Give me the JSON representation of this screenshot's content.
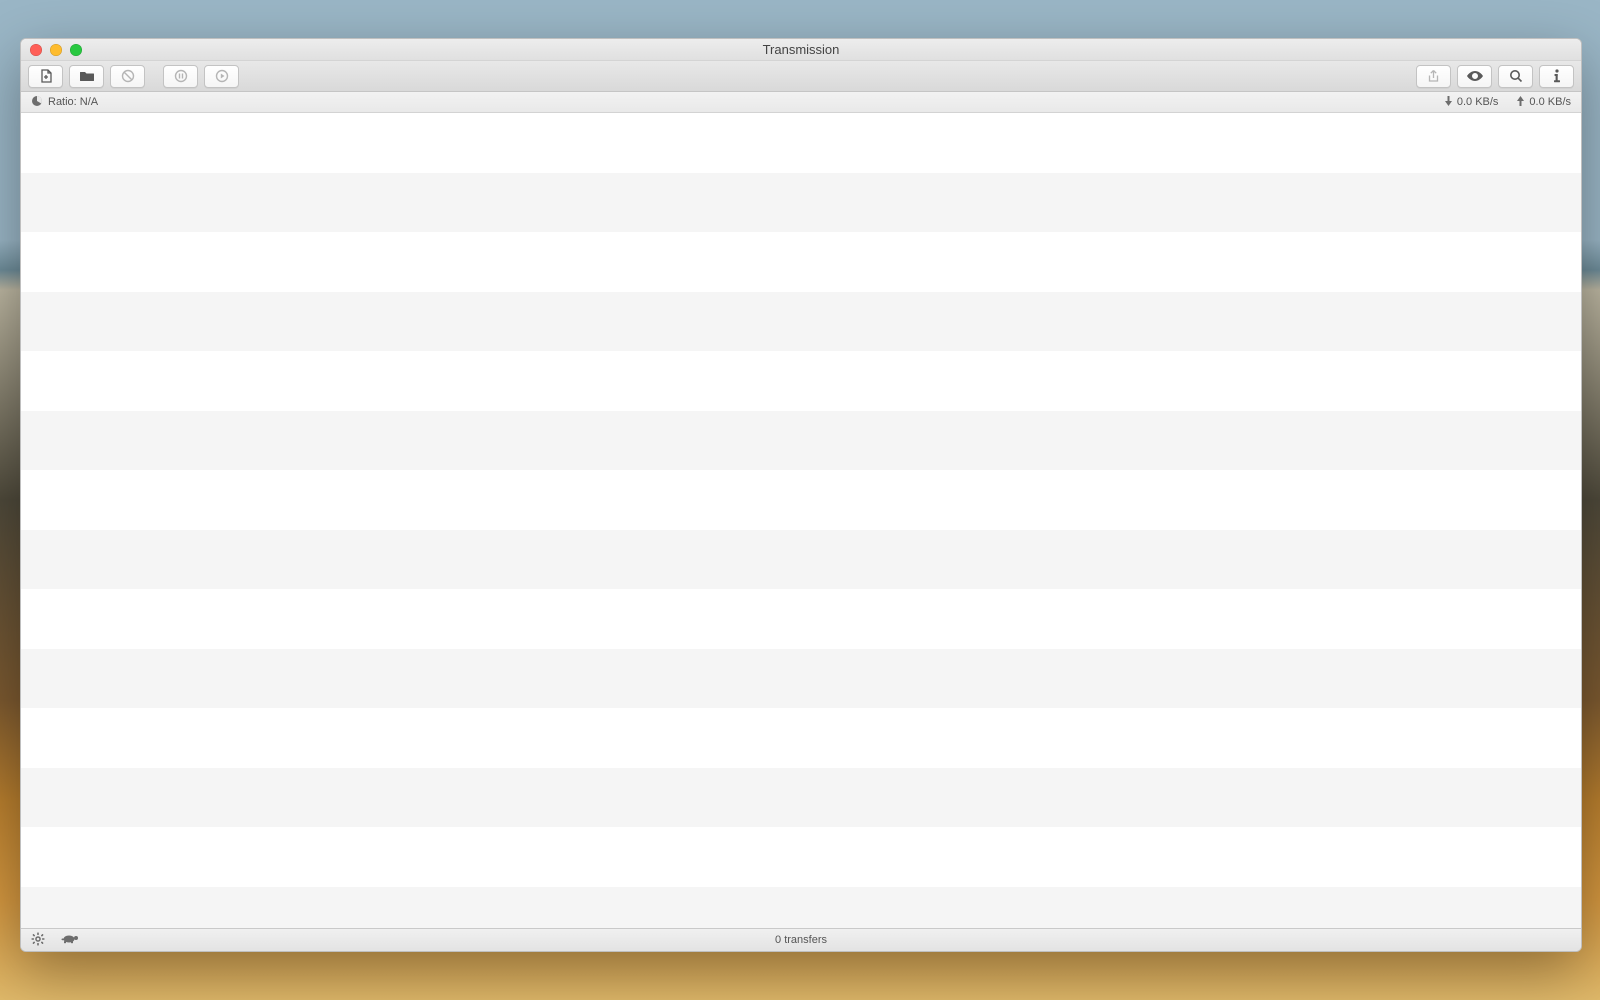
{
  "window": {
    "title": "Transmission"
  },
  "toolbar": {
    "new_label": "New Torrent",
    "open_label": "Open",
    "remove_label": "Remove",
    "pause_label": "Pause",
    "resume_label": "Resume",
    "share_label": "Share",
    "quicklook_label": "Quick Look",
    "search_label": "Search",
    "info_label": "Info"
  },
  "statusbar": {
    "ratio_label": "Ratio: N/A",
    "download_speed": "0.0 KB/s",
    "upload_speed": "0.0 KB/s"
  },
  "bottombar": {
    "transfers_label": "0 transfers",
    "settings_label": "Settings",
    "speedlimit_label": "Speed Limit"
  },
  "list": {
    "rows": []
  }
}
